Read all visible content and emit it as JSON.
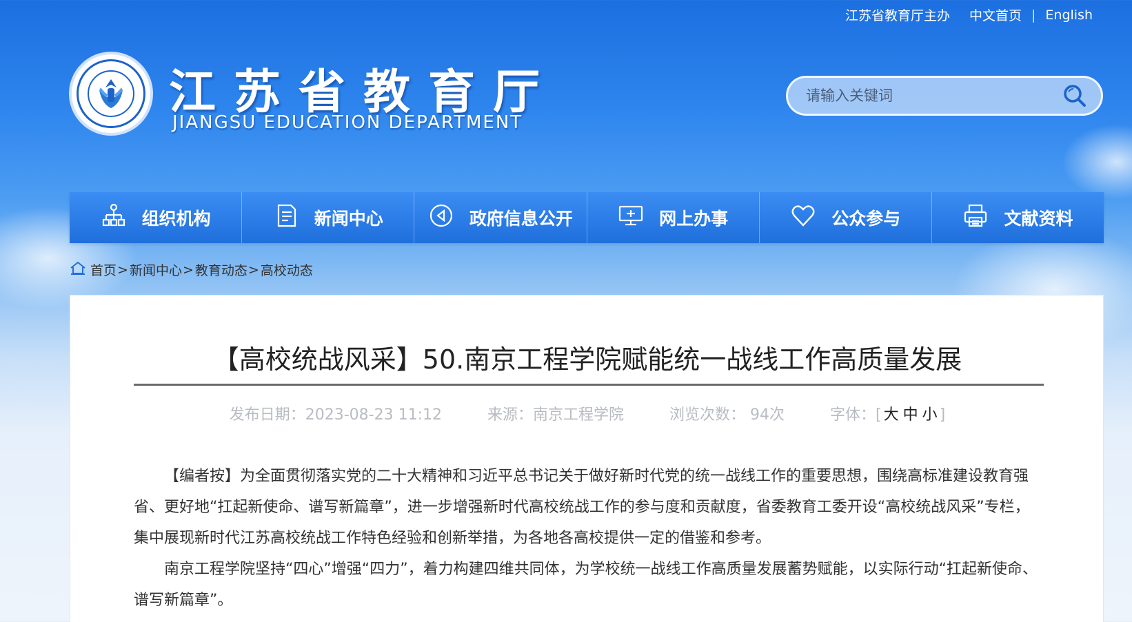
{
  "top_links": {
    "host": "江苏省教育厅主办",
    "home": "中文首页",
    "separator": "|",
    "english": "English"
  },
  "logo": {
    "title": "江苏省教育厅",
    "subtitle": "JIANGSU EDUCATION DEPARTMENT"
  },
  "search": {
    "placeholder": "请输入关键词"
  },
  "nav": [
    {
      "label": "组织机构",
      "icon": "org-chart-icon"
    },
    {
      "label": "新闻中心",
      "icon": "document-icon"
    },
    {
      "label": "政府信息公开",
      "icon": "play-circle-icon"
    },
    {
      "label": "网上办事",
      "icon": "monitor-icon"
    },
    {
      "label": "公众参与",
      "icon": "heart-icon"
    },
    {
      "label": "文献资料",
      "icon": "printer-icon"
    }
  ],
  "breadcrumb": [
    "首页",
    "新闻中心",
    "教育动态",
    "高校动态"
  ],
  "article": {
    "title": "【高校统战风采】50.南京工程学院赋能统一战线工作高质量发展",
    "publish": "发布日期：2023-08-23 11:12",
    "source": "来源：南京工程学院",
    "views": "浏览次数： 94次",
    "font_label": "字体：[",
    "font_large": "大",
    "font_medium": "中",
    "font_small": "小",
    "font_end": "]",
    "paragraphs": [
      "【编者按】为全面贯彻落实党的二十大精神和习近平总书记关于做好新时代党的统一战线工作的重要思想，围绕高标准建设教育强省、更好地“扛起新使命、谱写新篇章”，进一步增强新时代高校统战工作的参与度和贡献度，省委教育工委开设“高校统战风采”专栏，集中展现新时代江苏高校统战工作特色经验和创新举措，为各地各高校提供一定的借鉴和参考。",
      "南京工程学院坚持“四心”增强“四力”，着力构建四维共同体，为学校统一战线工作高质量发展蓄势赋能，以实际行动“扛起新使命、谱写新篇章”。"
    ]
  },
  "colors": {
    "nav_top": "#3b8df3",
    "nav_bottom": "#1f6fdc",
    "meta_text": "#b8bcc2"
  }
}
